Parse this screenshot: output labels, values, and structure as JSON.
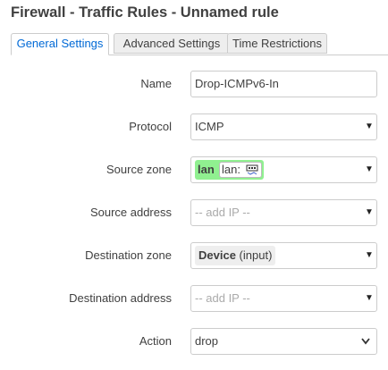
{
  "page": {
    "title": "Firewall - Traffic Rules - Unnamed rule"
  },
  "tabs": [
    {
      "label": "General Settings",
      "active": true
    },
    {
      "label": "Advanced Settings",
      "active": false
    },
    {
      "label": "Time Restrictions",
      "active": false
    }
  ],
  "form": {
    "name": {
      "label": "Name",
      "value": "Drop-ICMPv6-In"
    },
    "protocol": {
      "label": "Protocol",
      "value": "ICMP"
    },
    "source_zone": {
      "label": "Source zone",
      "zone": "lan",
      "interface_label": "lan:",
      "zone_color": "#90f090",
      "icon": "network-interface-icon"
    },
    "source_address": {
      "label": "Source address",
      "placeholder": "-- add IP --"
    },
    "destination_zone": {
      "label": "Destination zone",
      "device": "Device",
      "device_suffix": "(input)"
    },
    "destination_address": {
      "label": "Destination address",
      "placeholder": "-- add IP --"
    },
    "action": {
      "label": "Action",
      "value": "drop"
    }
  },
  "colors": {
    "active_tab": "#0069d6",
    "border": "#cccccc",
    "zone_lan": "#90f090"
  }
}
